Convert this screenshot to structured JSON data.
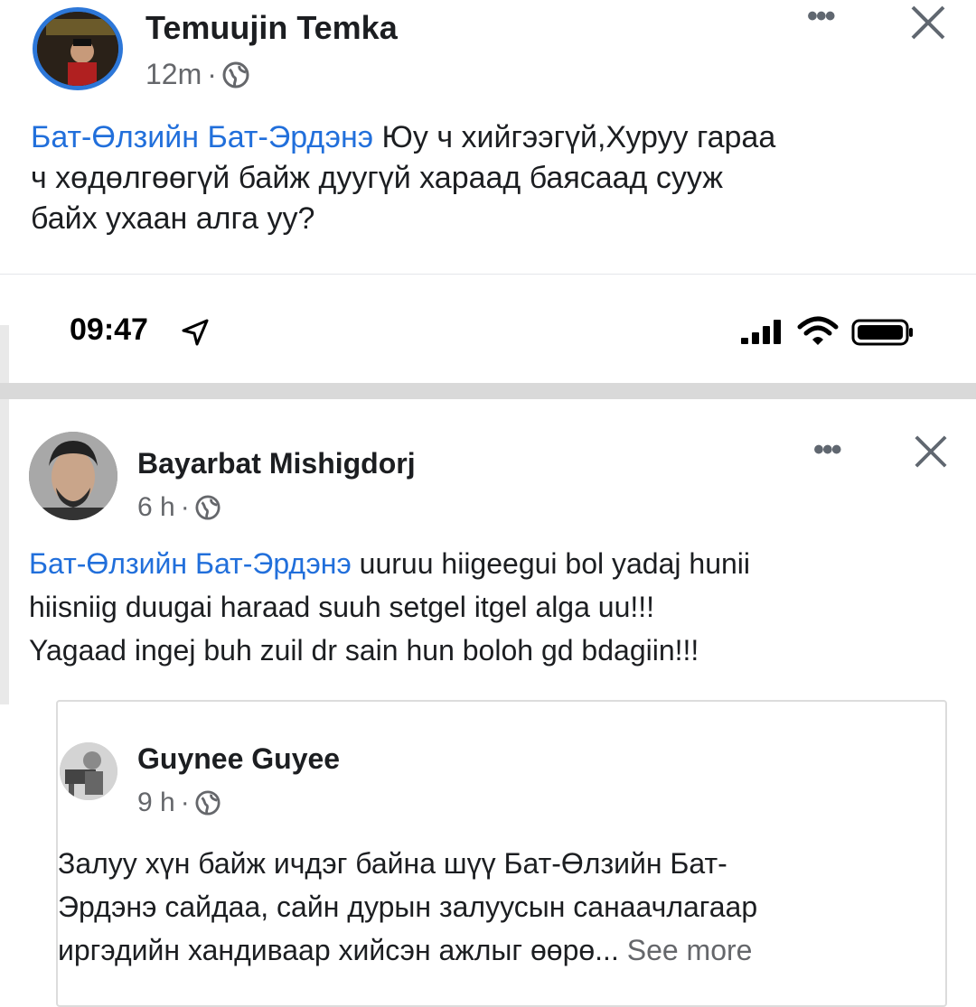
{
  "post1": {
    "author": "Temuujin Temka",
    "time": "12m",
    "separator": "·",
    "mention": "Бат-Өлзийн Бат-Эрдэнэ",
    "text_line1": " Юу ч хийгээгүй,Хуруу гараа",
    "text_line2": "ч хөдөлгөөгүй байж дуугүй хараад баясаад сууж",
    "text_line3": "байх ухаан алга уу?",
    "more_label": "•••",
    "close_label": "×"
  },
  "status_bar": {
    "time": "09:47"
  },
  "post2": {
    "author": "Bayarbat Mishigdorj",
    "time": "6 h",
    "separator": "·",
    "mention": "Бат-Өлзийн Бат-Эрдэнэ",
    "text_line1": " uuruu hiigeegui bol yadaj hunii",
    "text_line2": "hiisniig duugai haraad suuh setgel itgel alga uu!!!",
    "text_line3": "Yagaad ingej buh zuil dr sain hun boloh gd bdagiin!!!",
    "more_label": "•••",
    "close_label": "×"
  },
  "shared_post": {
    "author": "Guynee Guyee",
    "time": "9 h",
    "separator": "·",
    "text_line1": "Залуу хүн байж ичдэг байна шүү Бат-Өлзийн Бат-",
    "text_line2": "Эрдэнэ сайдаа,  сайн дурын залуусын санаачлагаар",
    "text_line3": "иргэдийн хандиваар хийсэн ажлыг өөрө...",
    "see_more": "See more"
  },
  "colors": {
    "mention": "#216fdb",
    "meta": "#65676b",
    "divider": "#d9d9d9"
  },
  "icons": [
    "globe-icon",
    "more-options-icon",
    "close-icon",
    "location-arrow-icon",
    "signal-icon",
    "wifi-icon",
    "battery-icon"
  ]
}
